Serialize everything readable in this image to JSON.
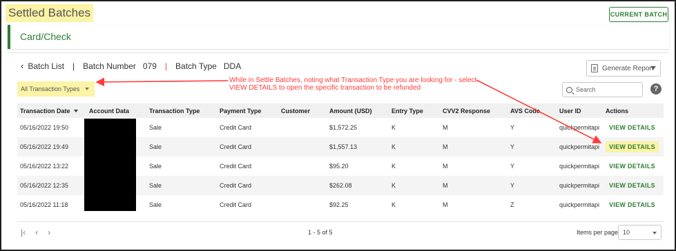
{
  "header": {
    "title": "Settled Batches",
    "current_batch_label": "CURRENT BATCH"
  },
  "section": {
    "title": "Card/Check"
  },
  "batch": {
    "back_label": "Batch List",
    "number_label": "Batch Number",
    "number_value": "079",
    "type_label": "Batch Type",
    "type_value": "DDA"
  },
  "toolbar": {
    "generate_report_label": "Generate Report",
    "filter_label": "All Transaction Types",
    "search_placeholder": "Search",
    "help_glyph": "?"
  },
  "annotation": {
    "text": "While in Settle Batches, noting what Transaction Type you are looking for - select VIEW DETAILS to open the specific transaction to be refunded",
    "color": "#ff3b3b"
  },
  "table": {
    "columns": [
      "Transaction Date",
      "Account Data",
      "Transaction Type",
      "Payment Type",
      "Customer",
      "Amount (USD)",
      "Entry Type",
      "CVV2 Response",
      "AVS Code",
      "User ID",
      "Actions"
    ],
    "rows": [
      {
        "date": "05/16/2022 19:50",
        "account": "",
        "type": "Sale",
        "payment": "Credit Card",
        "customer": "",
        "amount": "$1,572.25",
        "entry": "K",
        "cvv2": "M",
        "avs": "Y",
        "user": "quickpermitapi",
        "action": "VIEW DETAILS"
      },
      {
        "date": "05/16/2022 19:49",
        "account": "",
        "type": "Sale",
        "payment": "Credit Card",
        "customer": "",
        "amount": "$1,557.13",
        "entry": "K",
        "cvv2": "M",
        "avs": "Y",
        "user": "quickpermitapi",
        "action": "VIEW DETAILS"
      },
      {
        "date": "05/16/2022 13:22",
        "account": "",
        "type": "Sale",
        "payment": "Credit Card",
        "customer": "",
        "amount": "$95.20",
        "entry": "K",
        "cvv2": "M",
        "avs": "Y",
        "user": "quickpermitapi",
        "action": "VIEW DETAILS"
      },
      {
        "date": "05/16/2022 12:35",
        "account": "",
        "type": "Sale",
        "payment": "Credit Card",
        "customer": "",
        "amount": "$262.08",
        "entry": "K",
        "cvv2": "M",
        "avs": "Y",
        "user": "quickpermitapi",
        "action": "VIEW DETAILS"
      },
      {
        "date": "05/16/2022 11:18",
        "account": "",
        "type": "Sale",
        "payment": "Credit Card",
        "customer": "",
        "amount": "$92.25",
        "entry": "K",
        "cvv2": "M",
        "avs": "Z",
        "user": "quickpermitapi",
        "action": "VIEW DETAILS"
      }
    ]
  },
  "footer": {
    "first_glyph": "|‹",
    "prev_glyph": "‹",
    "next_glyph": "›",
    "page_count": "1 - 5 of 5",
    "items_per_page_label": "Items per page",
    "items_per_page_value": "10"
  },
  "colors": {
    "accent_green": "#2e7d32",
    "highlight_yellow": "#fbf3a6"
  }
}
